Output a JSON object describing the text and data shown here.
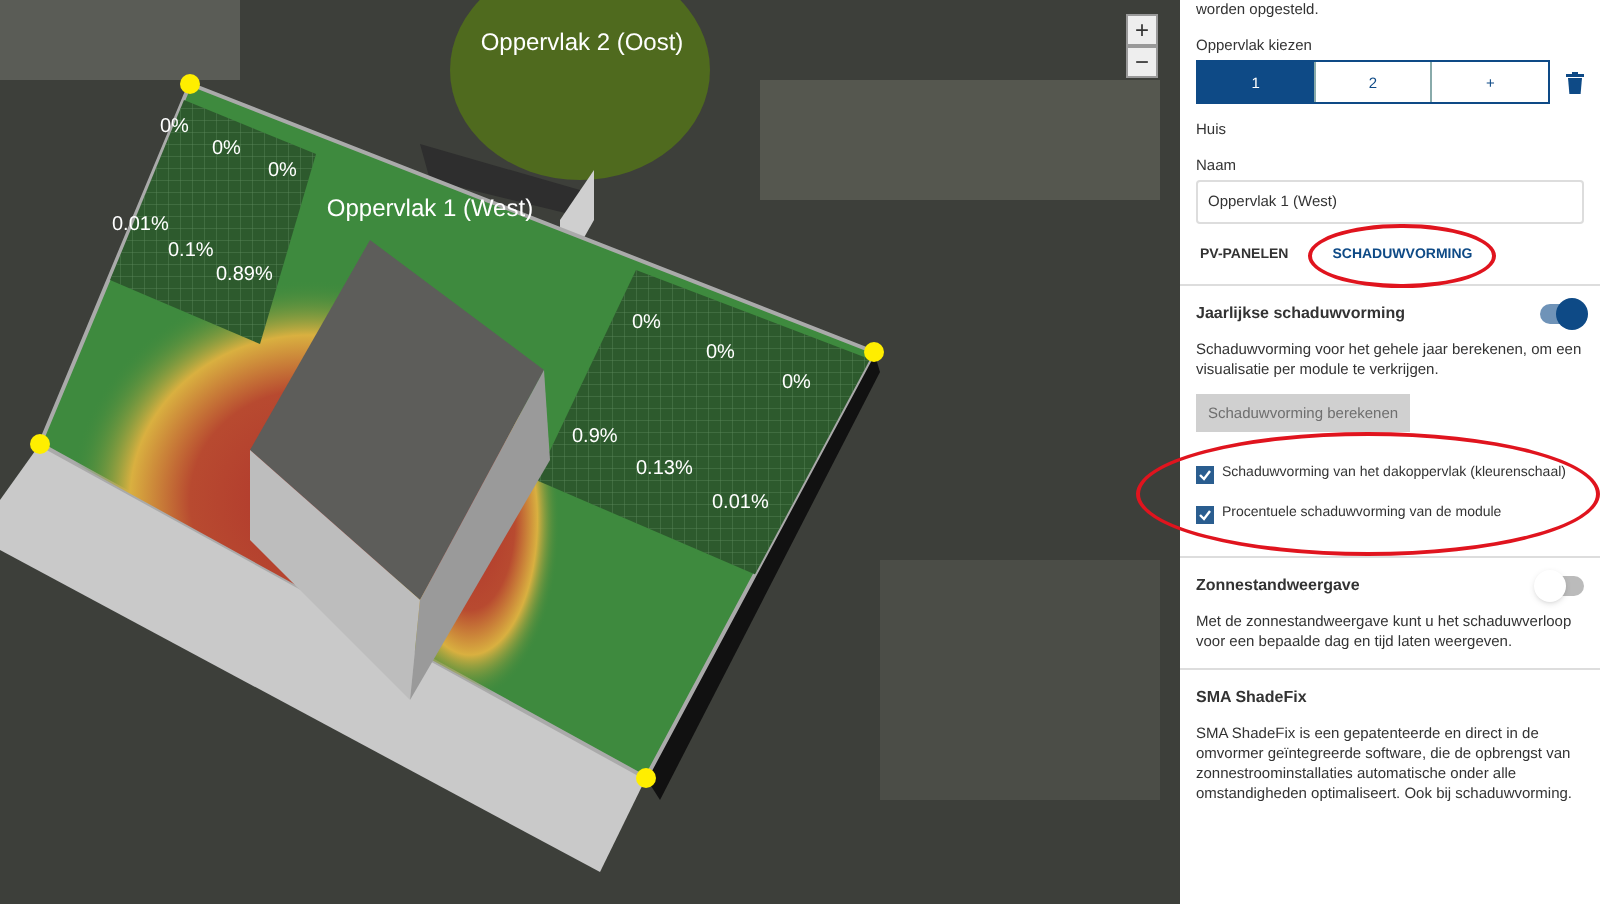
{
  "scene": {
    "surface_labels": [
      "Oppervlak 2 (Oost)",
      "Oppervlak 1 (West)"
    ],
    "modules": [
      "0%",
      "0%",
      "0%",
      "0.01%",
      "0.1%",
      "0.89%",
      "0%",
      "0%",
      "0%",
      "0.9%",
      "0.13%",
      "0.01%"
    ],
    "zoom_buttons": [
      "+",
      "−"
    ]
  },
  "panel": {
    "intro": "worden opgesteld.",
    "surface_picker": {
      "label": "Oppervlak kiezen",
      "options": [
        {
          "label": "1",
          "selected": true
        },
        {
          "label": "2",
          "selected": false
        },
        {
          "label": "+",
          "selected": false
        }
      ]
    },
    "house": "Huis",
    "name_field": {
      "label": "Naam",
      "value": "Oppervlak 1 (West)"
    },
    "tabs": [
      {
        "label": "PV-PANELEN",
        "selected": false
      },
      {
        "label": "SCHADUWVORMING",
        "selected": true
      }
    ],
    "sections": [
      {
        "title": "Jaarlijkse schaduwvorming",
        "toggle": true,
        "description": "Schaduwvorming voor het gehele jaar berekenen, om een visualisatie per module te verkrijgen.",
        "button": {
          "label": "Schaduwvorming berekenen",
          "disabled": true
        },
        "checkboxes": [
          {
            "label": "Schaduwvorming van het dakoppervlak (kleurenschaal)",
            "checked": true
          },
          {
            "label": "Procentuele schaduwvorming van de module",
            "checked": true
          }
        ]
      },
      {
        "title": "Zonnestandweergave",
        "toggle": false,
        "description": "Met de zonnestandweergave kunt u het schaduwverloop voor een bepaalde dag en tijd laten weergeven."
      },
      {
        "title": "SMA ShadeFix",
        "description": "SMA ShadeFix is een gepatenteerde en direct in de omvormer geïntegreerde software, die de opbrengst van zonnestroominstallaties automatische onder alle omstandigheden optimaliseert. Ook bij schaduwvorming."
      }
    ]
  }
}
